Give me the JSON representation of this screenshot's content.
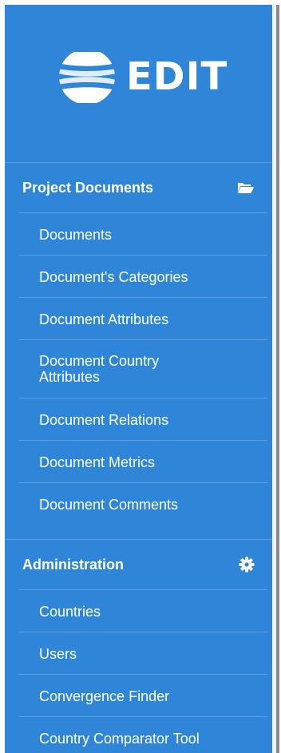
{
  "app": {
    "logo_text": "EDIT"
  },
  "sections": [
    {
      "title": "Project Documents",
      "icon": "folder-open-icon",
      "items": [
        {
          "label": "Documents"
        },
        {
          "label": "Document's Categories"
        },
        {
          "label": "Document Attributes"
        },
        {
          "label": "Document Country Attributes"
        },
        {
          "label": "Document Relations"
        },
        {
          "label": "Document Metrics"
        },
        {
          "label": "Document Comments"
        }
      ]
    },
    {
      "title": "Administration",
      "icon": "gear-icon",
      "items": [
        {
          "label": "Countries"
        },
        {
          "label": "Users"
        },
        {
          "label": "Convergence Finder"
        },
        {
          "label": "Country Comparator Tool"
        }
      ]
    }
  ],
  "colors": {
    "sidebar_bg": "#2f86d9",
    "text": "#ffffff"
  }
}
